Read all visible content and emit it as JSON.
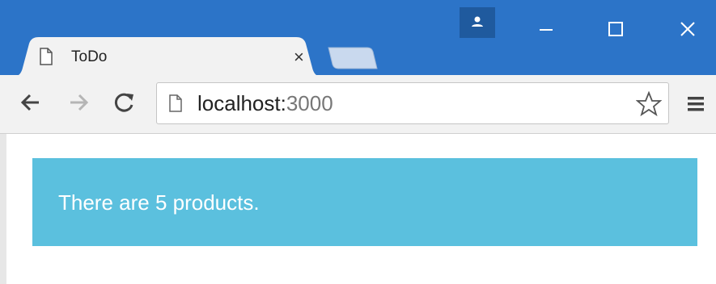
{
  "window": {
    "colors": {
      "titlebar": "#2c74c8",
      "toolbar": "#f2f2f2",
      "alert": "#5bc0de"
    }
  },
  "tab": {
    "title": "ToDo",
    "close_label": "×"
  },
  "address_bar": {
    "host": "localhost:",
    "port": "3000"
  },
  "content": {
    "message": "There are 5 products."
  }
}
